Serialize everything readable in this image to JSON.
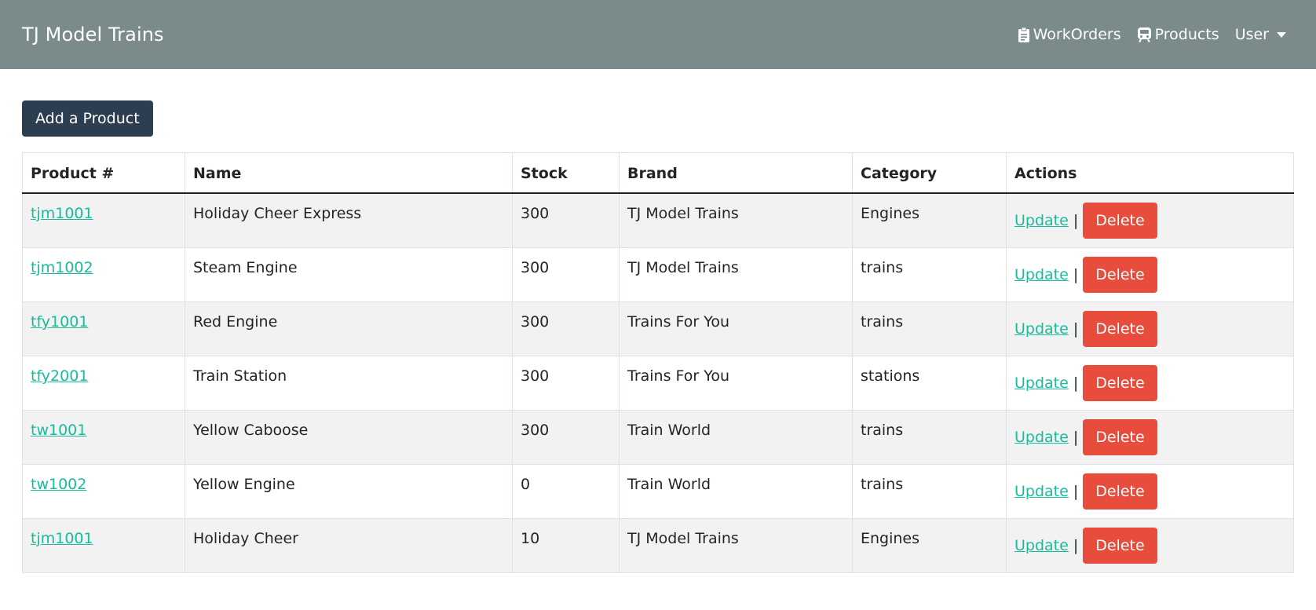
{
  "app": {
    "title": "TJ Model Trains"
  },
  "nav": {
    "workorders_label": "WorkOrders",
    "products_label": "Products",
    "user_label": "User",
    "workorders_icon": "clipboard-icon",
    "products_icon": "train-icon"
  },
  "toolbar": {
    "add_label": "Add a Product"
  },
  "table": {
    "headers": [
      "Product #",
      "Name",
      "Stock",
      "Brand",
      "Category",
      "Actions"
    ],
    "update_label": "Update",
    "separator": "|",
    "delete_label": "Delete",
    "rows": [
      {
        "product_no": "tjm1001",
        "name": "Holiday Cheer Express",
        "stock": "300",
        "brand": "TJ Model Trains",
        "category": "Engines"
      },
      {
        "product_no": "tjm1002",
        "name": "Steam Engine",
        "stock": "300",
        "brand": "TJ Model Trains",
        "category": "trains"
      },
      {
        "product_no": "tfy1001",
        "name": "Red Engine",
        "stock": "300",
        "brand": "Trains For You",
        "category": "trains"
      },
      {
        "product_no": "tfy2001",
        "name": "Train Station",
        "stock": "300",
        "brand": "Trains For You",
        "category": "stations"
      },
      {
        "product_no": "tw1001",
        "name": "Yellow Caboose",
        "stock": "300",
        "brand": "Train World",
        "category": "trains"
      },
      {
        "product_no": "tw1002",
        "name": "Yellow Engine",
        "stock": "0",
        "brand": "Train World",
        "category": "trains"
      },
      {
        "product_no": "tjm1001",
        "name": "Holiday Cheer",
        "stock": "10",
        "brand": "TJ Model Trains",
        "category": "Engines"
      }
    ]
  },
  "colors": {
    "navbar": "#7b8a8b",
    "primary": "#2c3e50",
    "link": "#18bc9c",
    "danger": "#e74c3c",
    "stripe": "#f2f2f2"
  }
}
